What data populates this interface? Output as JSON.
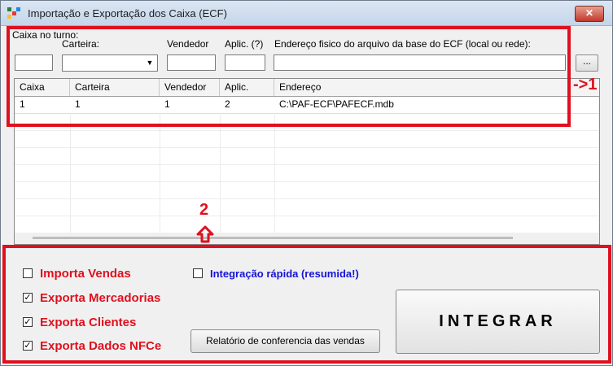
{
  "window": {
    "title": "Importação e Exportação dos Caixa (ECF)",
    "close_label": "✕"
  },
  "form": {
    "caixa_label": "Caixa no turno:",
    "carteira_label": "Carteira:",
    "vendedor_label": "Vendedor",
    "aplic_label": "Aplic. (?)",
    "endereco_label": "Endereço fisico do arquivo da base do ECF (local ou rede):",
    "caixa_value": "",
    "carteira_value": "",
    "vendedor_value": "",
    "aplic_value": "",
    "endereco_value": "",
    "browse_label": "..."
  },
  "grid": {
    "columns": [
      "Caixa",
      "Carteira",
      "Vendedor",
      "Aplic.",
      "Endereço"
    ],
    "rows": [
      [
        "1",
        "1",
        "1",
        "2",
        "C:\\PAF-ECF\\PAFECF.mdb"
      ]
    ]
  },
  "annotations": {
    "marker_1": "->1",
    "marker_2": "2"
  },
  "options": [
    {
      "label": "Importa Vendas",
      "checked": false
    },
    {
      "label": "Exporta Mercadorias",
      "checked": true
    },
    {
      "label": "Exporta Clientes",
      "checked": true
    },
    {
      "label": "Exporta Dados NFCe",
      "checked": true
    }
  ],
  "integracao": {
    "label": "Integração rápida (resumida!)",
    "checked": false
  },
  "buttons": {
    "relatorio": "Relatório de conferencia das vendas",
    "integrar": "INTEGRAR"
  },
  "colors": {
    "annotation_red": "#e0101e",
    "option_red": "#e0101e",
    "option_blue": "#1414d8"
  },
  "icons": {
    "app": "app-icon",
    "close": "close-icon",
    "dropdown": "chevron-down-icon",
    "check": "check-icon",
    "arrow": "arrow-up-icon"
  }
}
